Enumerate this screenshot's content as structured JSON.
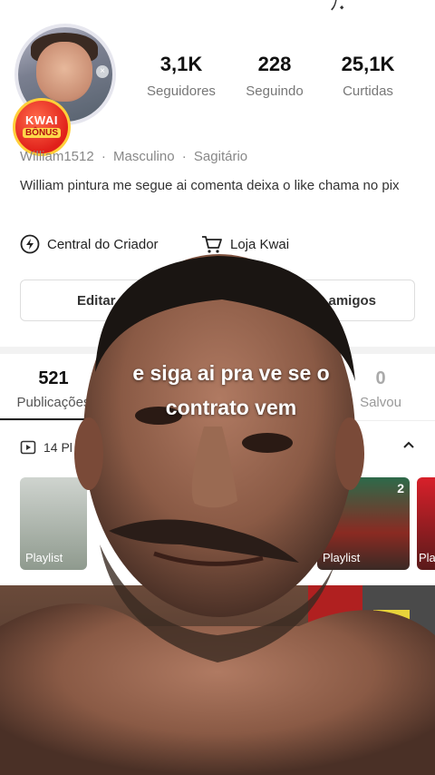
{
  "profile": {
    "username": "William1512",
    "gender": "Masculino",
    "sign": "Sagitário",
    "bio": "William pintura me segue ai comenta deixa o like chama no pix",
    "badge_top": "KWAI",
    "badge_bottom": "BÔNUS"
  },
  "stats": [
    {
      "value": "3,1K",
      "label": "Seguidores"
    },
    {
      "value": "228",
      "label": "Seguindo"
    },
    {
      "value": "25,1K",
      "label": "Curtidas"
    }
  ],
  "tools": [
    {
      "label": "Central do Criador",
      "icon": "lightning-circle-icon"
    },
    {
      "label": "Loja Kwai",
      "icon": "cart-icon"
    }
  ],
  "buttons": {
    "edit_visible": "Editar perfi",
    "friends_visible": "amigos"
  },
  "tabs": [
    {
      "count": "521",
      "label": "Publicações"
    },
    {
      "count": "0",
      "label": "Salvou"
    }
  ],
  "playlists": {
    "header_visible": "14 Pl",
    "items": [
      {
        "label": "Playlist"
      },
      {
        "label": "Playlist",
        "badge": "2"
      },
      {
        "label": "Pla"
      }
    ]
  },
  "overlay": {
    "caption_line1": "e siga ai pra ve se o",
    "caption_line2": "contrato vem"
  },
  "colors": {
    "accent_red": "#e0201a",
    "badge_gold": "#ffcf3a",
    "text_gray": "#888888"
  }
}
